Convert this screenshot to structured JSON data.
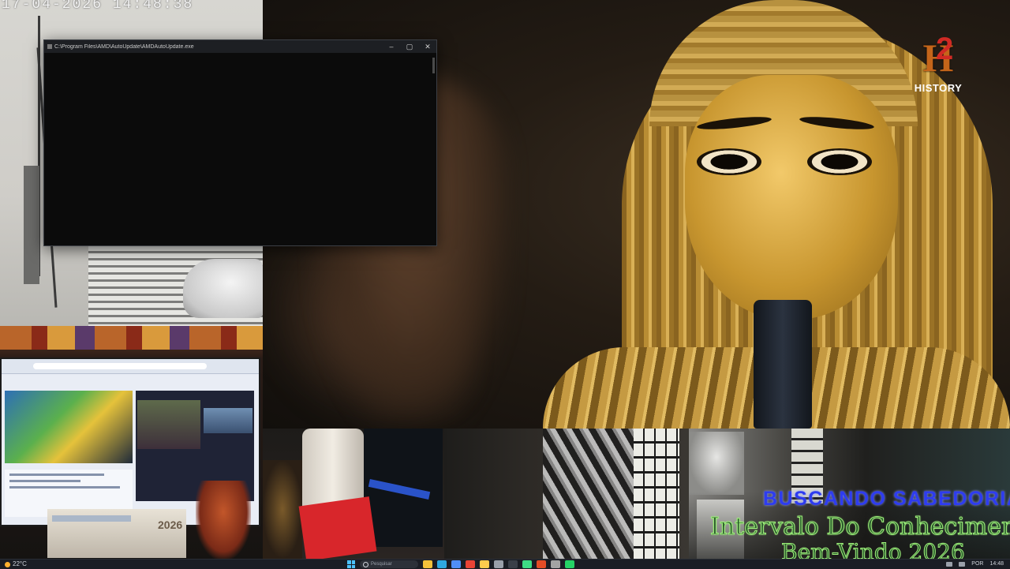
{
  "cam": {
    "timestamp": "17-04-2026 14:48:38"
  },
  "console": {
    "title": "C:\\Program Files\\AMD\\AutoUpdate\\AMDAutoUpdate.exe",
    "minimize_glyph": "–",
    "maximize_glyph": "▢",
    "close_glyph": "✕"
  },
  "channel_logo": {
    "mark": "H",
    "digit": "2",
    "name": "HISTORY"
  },
  "monitor_feed": {
    "calendar_year": "2026"
  },
  "overlay": {
    "line1": "BUSCANDO SABEDORIA",
    "line2": "Intervalo Do Conhecimento",
    "line3": "Bem-Vindo 2026"
  },
  "taskbar": {
    "weather": "22°C",
    "search_placeholder": "Pesquisar",
    "apps": [
      {
        "name": "file-explorer-icon",
        "color": "#f3c13a"
      },
      {
        "name": "edge-icon",
        "color": "#2fa8e0"
      },
      {
        "name": "store-icon",
        "color": "#4f8ef7"
      },
      {
        "name": "chrome-icon",
        "color": "#e94335"
      },
      {
        "name": "folder-icon",
        "color": "#ffcc4d"
      },
      {
        "name": "settings-icon",
        "color": "#9aa0aa"
      },
      {
        "name": "terminal-icon",
        "color": "#3a3f48"
      },
      {
        "name": "app-icon-8",
        "color": "#3ddc84"
      },
      {
        "name": "app-icon-9",
        "color": "#e34c26"
      },
      {
        "name": "app-icon-10",
        "color": "#a3a3a3"
      },
      {
        "name": "app-icon-11",
        "color": "#25d366"
      }
    ],
    "lang": "POR",
    "time": "14:48"
  }
}
